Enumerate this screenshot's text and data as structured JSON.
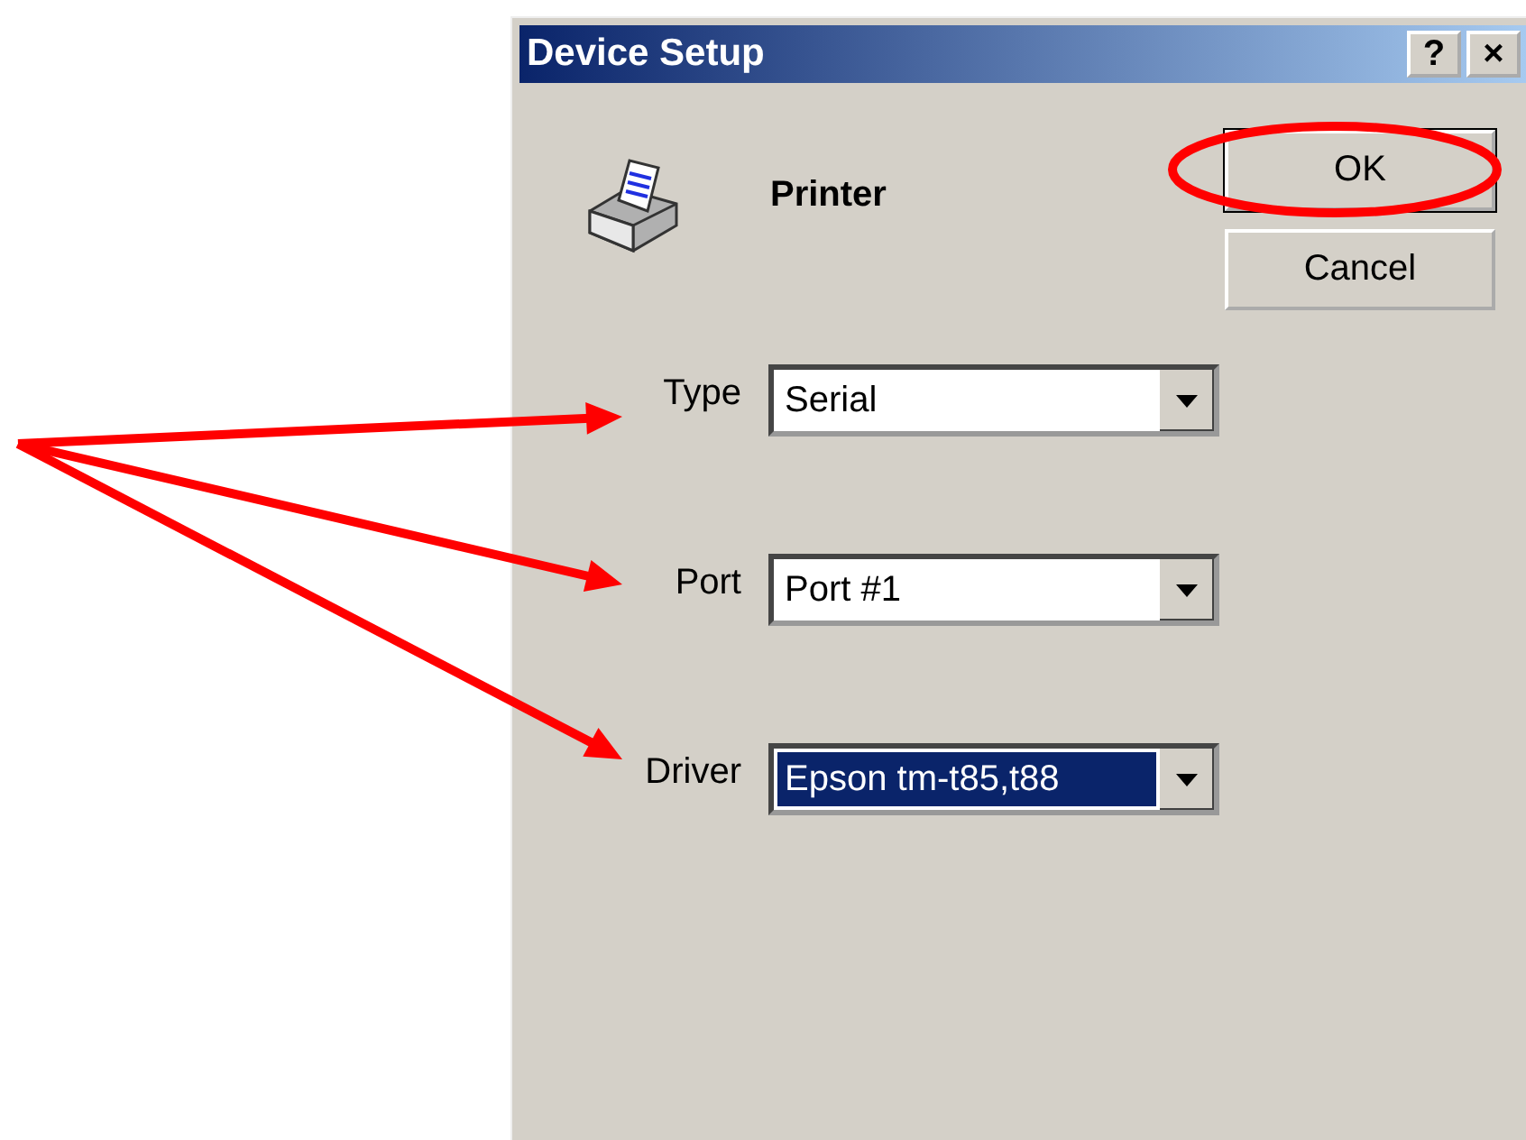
{
  "window": {
    "title": "Device Setup",
    "help_button": "?",
    "close_button": "×"
  },
  "device": {
    "name": "Printer"
  },
  "buttons": [
    {
      "label": "OK",
      "circled": true
    },
    {
      "label": "Cancel",
      "circled": false
    }
  ],
  "fields": [
    {
      "label": "Type",
      "value": "Serial",
      "focused": false,
      "pointed_at": true
    },
    {
      "label": "Port",
      "value": "Port #1",
      "focused": false,
      "pointed_at": true
    },
    {
      "label": "Driver",
      "value": "Epson tm-t85,t88",
      "focused": true,
      "pointed_at": true
    }
  ]
}
